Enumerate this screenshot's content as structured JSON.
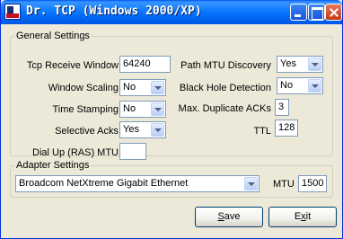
{
  "window": {
    "title": "Dr. TCP (Windows 2000/XP)"
  },
  "general": {
    "legend": "General Settings",
    "tcp_receive_window": {
      "label": "Tcp Receive Window",
      "value": "64240"
    },
    "window_scaling": {
      "label": "Window Scaling",
      "value": "No"
    },
    "time_stamping": {
      "label": "Time Stamping",
      "value": "No"
    },
    "selective_acks": {
      "label": "Selective Acks",
      "value": "Yes"
    },
    "dial_up_mtu": {
      "label": "Dial Up (RAS) MTU",
      "value": ""
    },
    "path_mtu_discovery": {
      "label": "Path MTU Discovery",
      "value": "Yes"
    },
    "black_hole_detection": {
      "label": "Black Hole Detection",
      "value": "No"
    },
    "max_duplicate_acks": {
      "label": "Max. Duplicate ACKs",
      "value": "3"
    },
    "ttl": {
      "label": "TTL",
      "value": "128"
    }
  },
  "adapter": {
    "legend": "Adapter Settings",
    "selected_adapter": "Broadcom NetXtreme Gigabit Ethernet",
    "mtu_label": "MTU",
    "mtu_value": "1500"
  },
  "buttons": {
    "save_prefix": "",
    "save_mnemonic": "S",
    "save_rest": "ave",
    "exit_prefix": "E",
    "exit_mnemonic": "x",
    "exit_rest": "it"
  },
  "colors": {
    "titlebar": "#0058ee",
    "window_bg": "#ece9d8",
    "field_border": "#7f9db9"
  },
  "icons": [
    "app-icon",
    "minimize-icon",
    "maximize-icon",
    "close-icon",
    "chevron-down-icon"
  ]
}
